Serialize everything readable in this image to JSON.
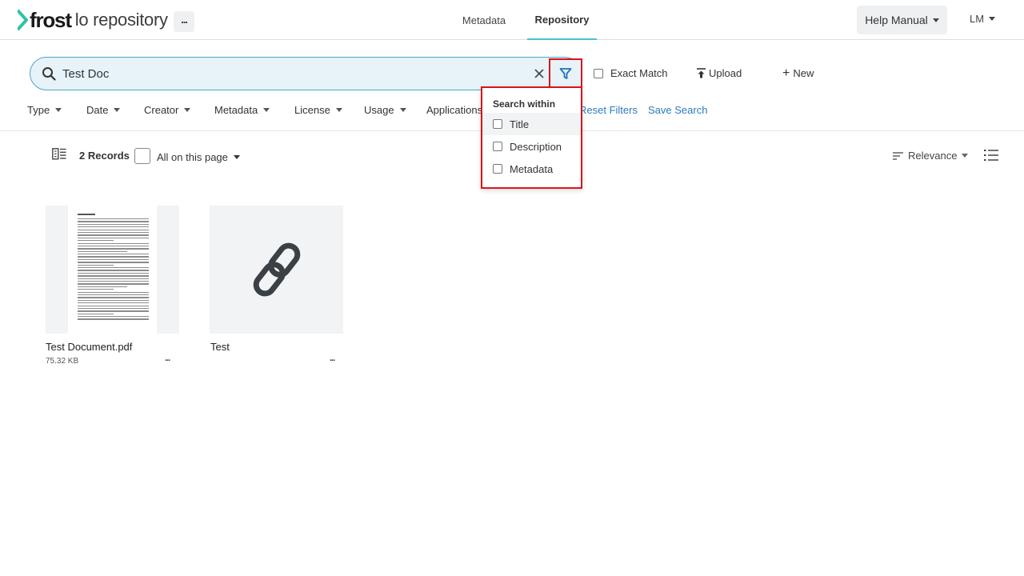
{
  "header": {
    "logo_word": "frost",
    "logo_sub": "lo repository",
    "more_label": "...",
    "tabs": [
      {
        "label": "Metadata",
        "active": false
      },
      {
        "label": "Repository",
        "active": true
      }
    ],
    "help_label": "Help Manual",
    "user_initials": "LM",
    "accent_color": "#49c3cd"
  },
  "search": {
    "value": "Test Doc",
    "exact_match_label": "Exact Match",
    "exact_match_checked": false,
    "upload_label": "Upload",
    "new_label": "New"
  },
  "filters": {
    "items": [
      "Type",
      "Date",
      "Creator",
      "Metadata",
      "License",
      "Usage",
      "Applications"
    ],
    "reset_label": "Reset Filters",
    "save_label": "Save Search",
    "link_color": "#2a7bbf"
  },
  "search_within": {
    "title": "Search within",
    "options": [
      {
        "label": "Title",
        "checked": false,
        "highlighted": true
      },
      {
        "label": "Description",
        "checked": false,
        "highlighted": false
      },
      {
        "label": "Metadata",
        "checked": false,
        "highlighted": false
      }
    ],
    "highlight_color": "#d8151b"
  },
  "results": {
    "count_label": "2 Records",
    "select_label": "All on this page",
    "sort_label": "Relevance",
    "items": [
      {
        "title": "Test Document.pdf",
        "size": "75.32 KB",
        "icon": "pdf-document-thumbnail",
        "more": "..."
      },
      {
        "title": "Test",
        "size": "",
        "icon": "link-icon",
        "more": "..."
      }
    ]
  }
}
